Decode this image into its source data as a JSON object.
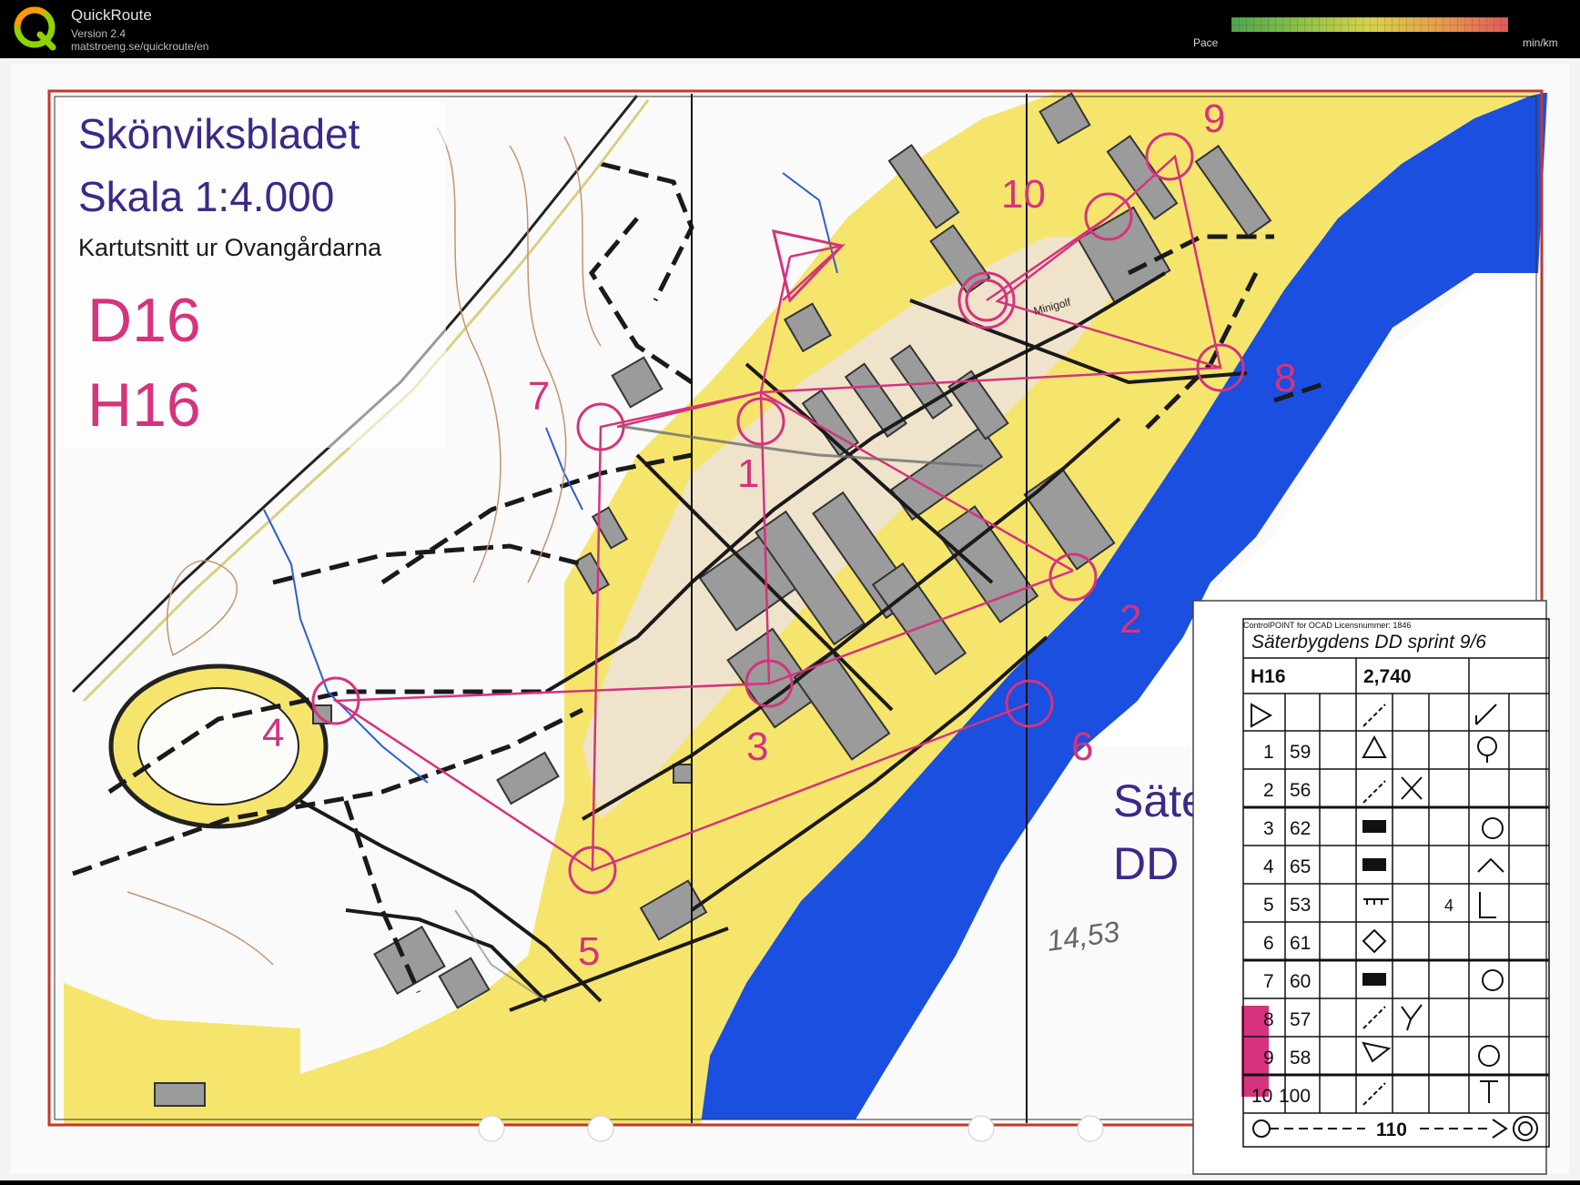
{
  "app": {
    "name": "QuickRoute",
    "version": "Version 2.4",
    "url": "matstroeng.se/quickroute/en",
    "pace_label": "Pace",
    "pace_unit": "min/km",
    "logo_letter": "Q"
  },
  "map": {
    "title": "Skönviksbladet",
    "scale": "Skala 1:4.000",
    "subtitle": "Kartutsnitt ur Ovangårdarna",
    "classes": [
      "D16",
      "H16"
    ],
    "event_partial_1": "Säte",
    "event_partial_2": "DD",
    "minigolf_label": "Minigolf",
    "handwritten_time": "14,53",
    "control_numbers": [
      "1",
      "2",
      "3",
      "4",
      "5",
      "6",
      "7",
      "8",
      "9",
      "10"
    ],
    "colors": {
      "course": "#d5337d",
      "water": "#1650e6",
      "urban": "#f7e66f",
      "building": "#9a9a9a",
      "title": "#3d2889"
    }
  },
  "description_sheet": {
    "header_small": "ControlPOINT for OCAD Licensnummer: 1846",
    "event": "Säterbygdens DD sprint 9/6",
    "class": "H16",
    "length": "2,740",
    "rows": [
      {
        "num": "1",
        "code": "59"
      },
      {
        "num": "2",
        "code": "56"
      },
      {
        "num": "3",
        "code": "62"
      },
      {
        "num": "4",
        "code": "65"
      },
      {
        "num": "5",
        "code": "53",
        "extra": "4"
      },
      {
        "num": "6",
        "code": "61"
      },
      {
        "num": "7",
        "code": "60"
      },
      {
        "num": "8",
        "code": "57"
      },
      {
        "num": "9",
        "code": "58"
      },
      {
        "num": "10",
        "code": "100"
      }
    ],
    "finish_distance": "110"
  }
}
